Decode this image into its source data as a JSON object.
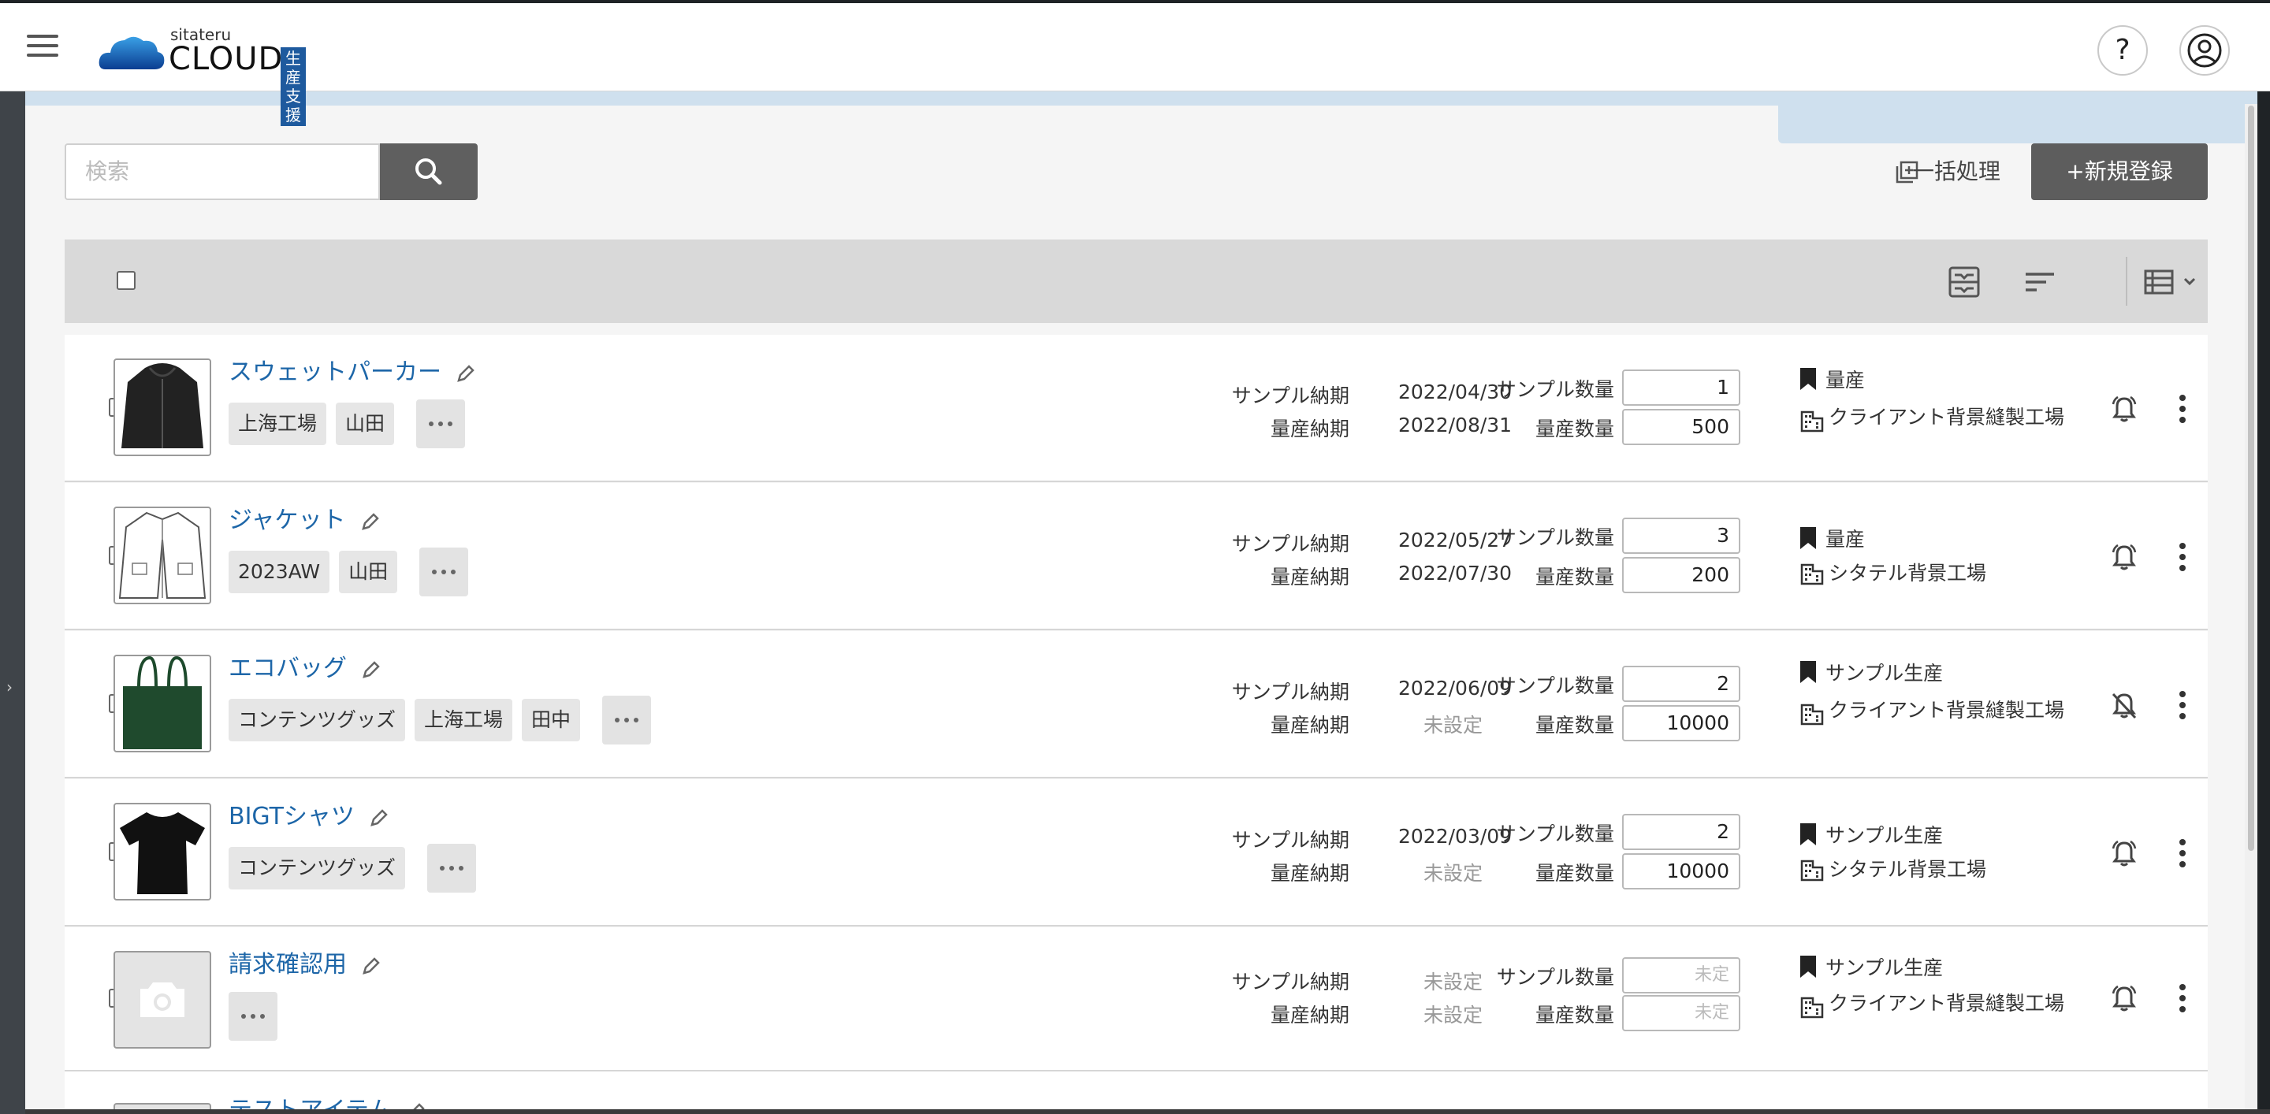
{
  "header": {
    "logo_small": "sitateru",
    "logo_big": "CLOUD",
    "logo_badge": "生産支援",
    "help_label": "?"
  },
  "search": {
    "placeholder": "検索"
  },
  "actions": {
    "bulk_label": "一括処理",
    "new_label": "+新規登録"
  },
  "labels": {
    "sample_due": "サンプル納期",
    "mass_due": "量産納期",
    "sample_qty": "サンプル数量",
    "mass_qty": "量産数量"
  },
  "items": [
    {
      "name": "スウェットパーカー",
      "tags": [
        "上海工場",
        "山田"
      ],
      "sample_due": "2022/04/30",
      "mass_due": "2022/08/31",
      "sample_qty": "1",
      "mass_qty": "500",
      "status": "量産",
      "factory": "クライアント背景縫製工場",
      "thumb": "hoodie"
    },
    {
      "name": "ジャケット",
      "tags": [
        "2023AW",
        "山田"
      ],
      "sample_due": "2022/05/27",
      "mass_due": "2022/07/30",
      "sample_qty": "3",
      "mass_qty": "200",
      "status": "量産",
      "factory": "シタテル背景工場",
      "thumb": "jacket"
    },
    {
      "name": "エコバッグ",
      "tags": [
        "コンテンツグッズ",
        "上海工場",
        "田中"
      ],
      "sample_due": "2022/06/09",
      "mass_due": "未設定",
      "sample_qty": "2",
      "mass_qty": "10000",
      "status": "サンプル生産",
      "factory": "クライアント背景縫製工場",
      "thumb": "bag"
    },
    {
      "name": "BIGTシャツ",
      "tags": [
        "コンテンツグッズ"
      ],
      "sample_due": "2022/03/09",
      "mass_due": "未設定",
      "sample_qty": "2",
      "mass_qty": "10000",
      "status": "サンプル生産",
      "factory": "シタテル背景工場",
      "thumb": "tshirt"
    },
    {
      "name": "請求確認用",
      "tags": [],
      "sample_due": "未設定",
      "mass_due": "未設定",
      "sample_qty_placeholder": "未定",
      "mass_qty_placeholder": "未定",
      "status": "サンプル生産",
      "factory": "クライアント背景縫製工場",
      "thumb": "placeholder"
    },
    {
      "name": "テストアイテム"
    }
  ],
  "colors": {
    "link": "#1d66a8",
    "badge": "#1e5a9e",
    "button_dark": "#5d5d5d"
  }
}
